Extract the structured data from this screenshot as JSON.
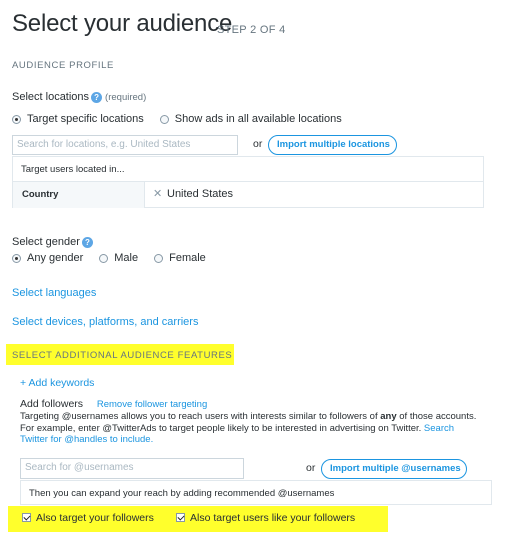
{
  "header": {
    "title": "Select your audience",
    "step": "STEP 2 OF 4"
  },
  "profile": {
    "section_title": "AUDIENCE PROFILE"
  },
  "locations": {
    "label": "Select locations",
    "required": "(required)",
    "options": [
      "Target specific locations",
      "Show ads in all available locations"
    ],
    "selected": 0,
    "search_placeholder": "Search for locations, e.g. United States",
    "or": "or",
    "import_button": "Import multiple locations",
    "targeted_header": "Target users located in...",
    "rows": [
      {
        "type": "Country",
        "value": "United States",
        "remove_glyph": "✕"
      }
    ]
  },
  "gender": {
    "label": "Select gender",
    "options": [
      "Any gender",
      "Male",
      "Female"
    ],
    "selected": 0
  },
  "links": {
    "languages": "Select languages",
    "devices": "Select devices, platforms, and carriers"
  },
  "additional": {
    "section_title": "SELECT ADDITIONAL AUDIENCE FEATURES",
    "add_keywords": "+ Add keywords",
    "followers_label": "Add followers",
    "remove_link": "Remove follower targeting",
    "description_1": "Targeting @usernames allows you to reach users with interests similar to followers of ",
    "description_any": "any",
    "description_2": " of those accounts. For example, enter @TwitterAds to target people likely to be interested in advertising on Twitter. ",
    "description_link": "Search Twitter for @handles to include.",
    "search_placeholder": "Search for @usernames",
    "or": "or",
    "import_button": "Import multiple @usernames",
    "expand_note": "Then you can expand your reach by adding recommended @usernames",
    "checkbox_followers": "Also target your followers",
    "checkbox_like": "Also target users like your followers"
  },
  "colors": {
    "accent": "#1b95e0",
    "highlight": "#ffff2c",
    "text": "#292f33"
  }
}
